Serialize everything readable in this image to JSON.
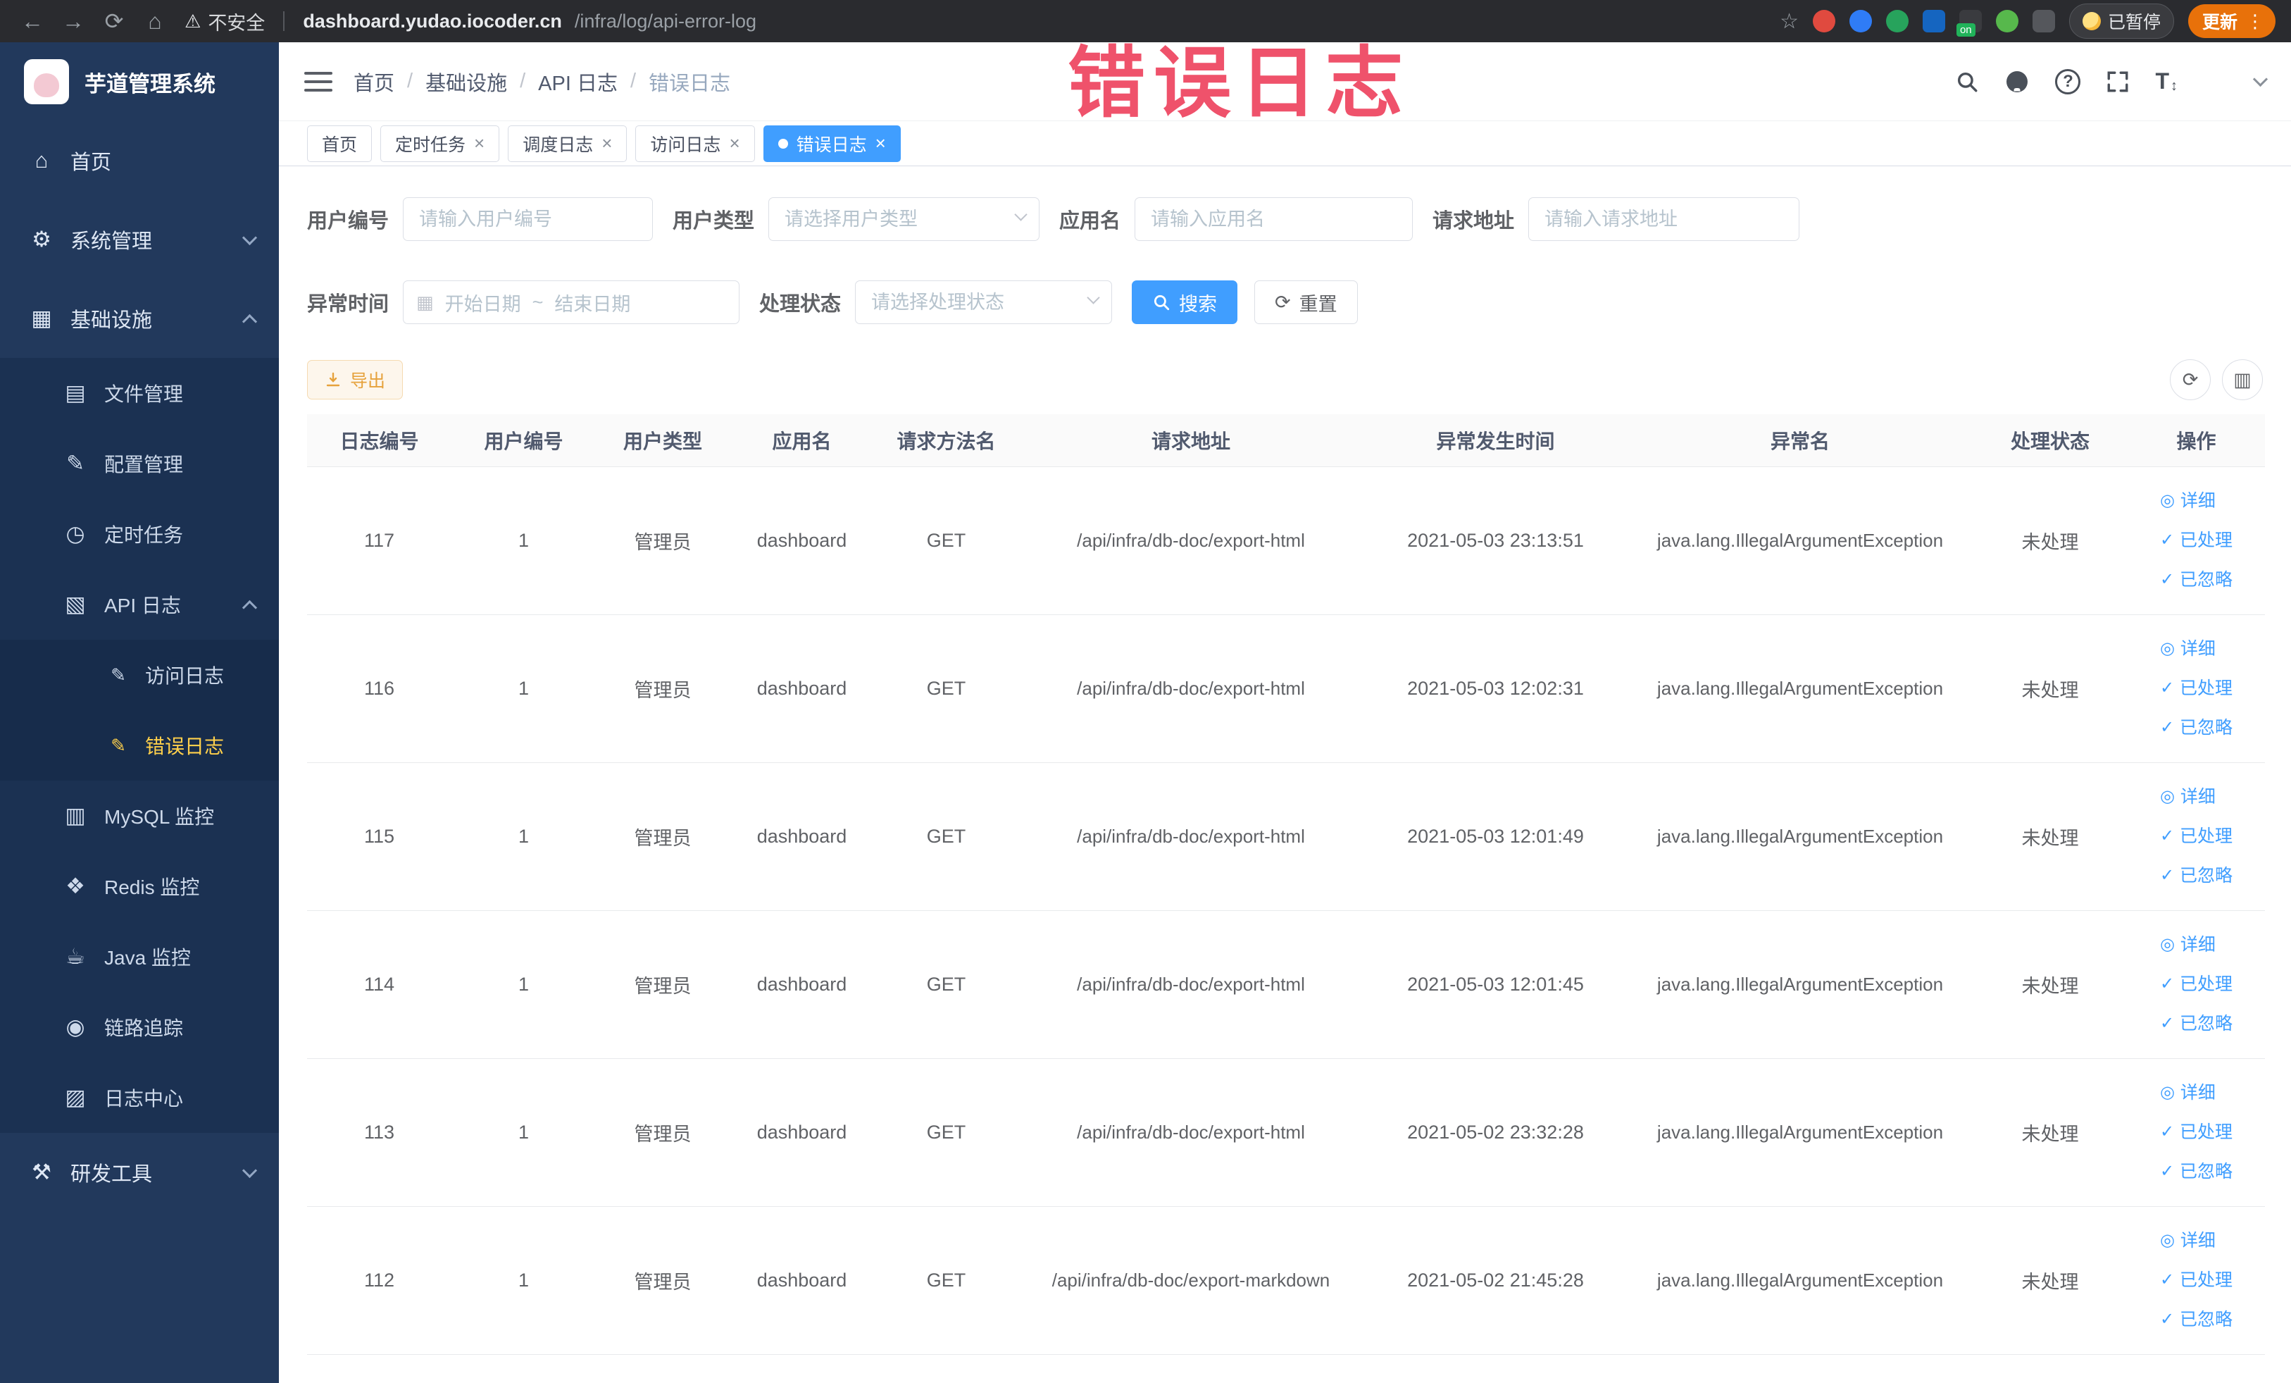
{
  "annotation": {
    "watermark": "错误日志"
  },
  "browser": {
    "security_label": "不安全",
    "url_domain": "dashboard.yudao.iocoder.cn",
    "url_path": "/infra/log/api-error-log",
    "ext_on_badge": "on",
    "paused_label": "已暂停",
    "update_label": "更新"
  },
  "icons": {
    "back": "←",
    "forward": "→",
    "reload": "⟳",
    "home": "⌂",
    "warning": "⚠",
    "star": "☆",
    "dots": "⋮",
    "close": "×",
    "question": "?",
    "font_size": "T",
    "font_size_arrows": "↕",
    "calendar": "▦",
    "refresh": "⟳",
    "columns": "▥",
    "eye": "◎",
    "check": "✓"
  },
  "sidebar": {
    "logo_title": "芋道管理系统",
    "items": [
      {
        "label": "首页",
        "glyph": "⌂"
      },
      {
        "label": "系统管理",
        "glyph": "⚙"
      },
      {
        "label": "基础设施",
        "glyph": "▦"
      },
      {
        "label": "文件管理",
        "glyph": "▤"
      },
      {
        "label": "配置管理",
        "glyph": "✎"
      },
      {
        "label": "定时任务",
        "glyph": "◷"
      },
      {
        "label": "API 日志",
        "glyph": "▧"
      },
      {
        "label": "访问日志",
        "glyph": "✎"
      },
      {
        "label": "错误日志",
        "glyph": "✎"
      },
      {
        "label": "MySQL 监控",
        "glyph": "▥"
      },
      {
        "label": "Redis 监控",
        "glyph": "❖"
      },
      {
        "label": "Java 监控",
        "glyph": "☕"
      },
      {
        "label": "链路追踪",
        "glyph": "◉"
      },
      {
        "label": "日志中心",
        "glyph": "▨"
      },
      {
        "label": "研发工具",
        "glyph": "⚒"
      }
    ]
  },
  "header": {
    "breadcrumb": [
      "首页",
      "基础设施",
      "API 日志",
      "错误日志"
    ]
  },
  "tabs": [
    {
      "label": "首页"
    },
    {
      "label": "定时任务"
    },
    {
      "label": "调度日志"
    },
    {
      "label": "访问日志"
    },
    {
      "label": "错误日志"
    }
  ],
  "filters": {
    "user_id": {
      "label": "用户编号",
      "placeholder": "请输入用户编号"
    },
    "user_type": {
      "label": "用户类型",
      "placeholder": "请选择用户类型"
    },
    "app_name": {
      "label": "应用名",
      "placeholder": "请输入应用名"
    },
    "request_url": {
      "label": "请求地址",
      "placeholder": "请输入请求地址"
    },
    "exception_time": {
      "label": "异常时间",
      "start_placeholder": "开始日期",
      "separator": "~",
      "end_placeholder": "结束日期"
    },
    "process_status": {
      "label": "处理状态",
      "placeholder": "请选择处理状态"
    },
    "search_label": "搜索",
    "reset_label": "重置"
  },
  "toolbar": {
    "export_label": "导出"
  },
  "table": {
    "columns": [
      "日志编号",
      "用户编号",
      "用户类型",
      "应用名",
      "请求方法名",
      "请求地址",
      "异常发生时间",
      "异常名",
      "处理状态",
      "操作"
    ],
    "actions": [
      "详细",
      "已处理",
      "已忽略"
    ],
    "rows": [
      {
        "id": "117",
        "user_id": "1",
        "user_type": "管理员",
        "app": "dashboard",
        "method": "GET",
        "url": "/api/infra/db-doc/export-html",
        "time": "2021-05-03 23:13:51",
        "exception": "java.lang.IllegalArgumentException",
        "status": "未处理"
      },
      {
        "id": "116",
        "user_id": "1",
        "user_type": "管理员",
        "app": "dashboard",
        "method": "GET",
        "url": "/api/infra/db-doc/export-html",
        "time": "2021-05-03 12:02:31",
        "exception": "java.lang.IllegalArgumentException",
        "status": "未处理"
      },
      {
        "id": "115",
        "user_id": "1",
        "user_type": "管理员",
        "app": "dashboard",
        "method": "GET",
        "url": "/api/infra/db-doc/export-html",
        "time": "2021-05-03 12:01:49",
        "exception": "java.lang.IllegalArgumentException",
        "status": "未处理"
      },
      {
        "id": "114",
        "user_id": "1",
        "user_type": "管理员",
        "app": "dashboard",
        "method": "GET",
        "url": "/api/infra/db-doc/export-html",
        "time": "2021-05-03 12:01:45",
        "exception": "java.lang.IllegalArgumentException",
        "status": "未处理"
      },
      {
        "id": "113",
        "user_id": "1",
        "user_type": "管理员",
        "app": "dashboard",
        "method": "GET",
        "url": "/api/infra/db-doc/export-html",
        "time": "2021-05-02 23:32:28",
        "exception": "java.lang.IllegalArgumentException",
        "status": "未处理"
      },
      {
        "id": "112",
        "user_id": "1",
        "user_type": "管理员",
        "app": "dashboard",
        "method": "GET",
        "url": "/api/infra/db-doc/export-markdown",
        "time": "2021-05-02 21:45:28",
        "exception": "java.lang.IllegalArgumentException",
        "status": "未处理"
      }
    ]
  }
}
